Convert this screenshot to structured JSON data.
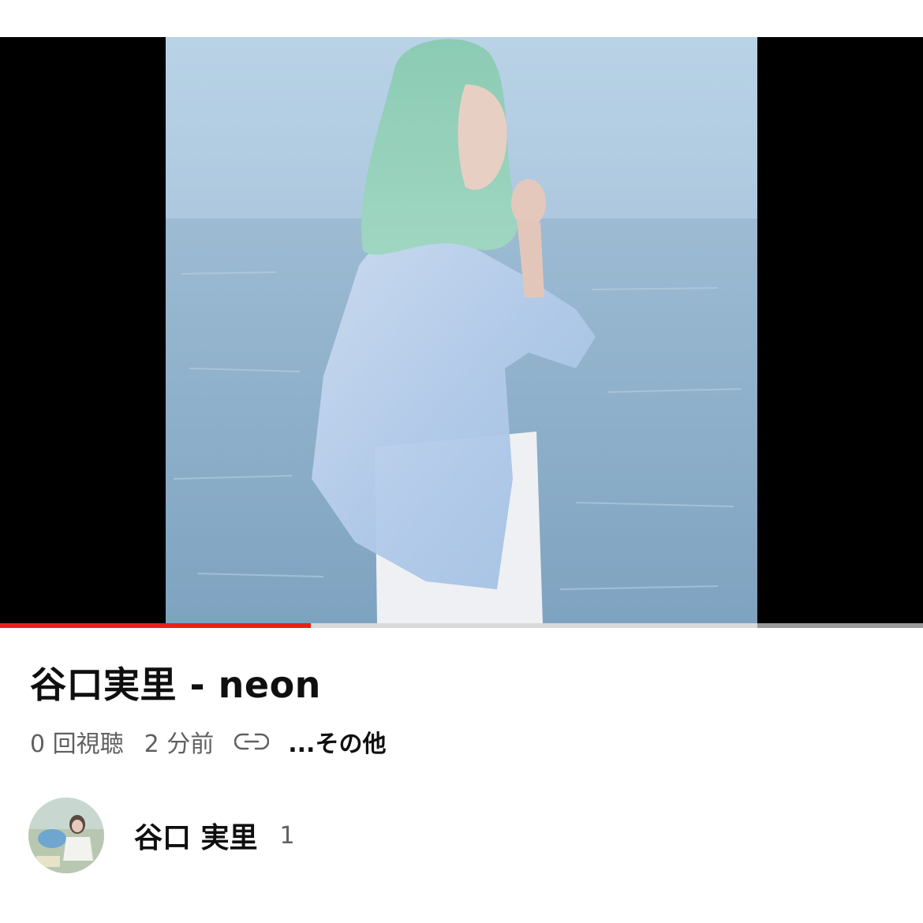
{
  "video": {
    "title": "谷口実里 - neon",
    "progress_fraction": 0.337,
    "views": "0 回視聴",
    "age": "2 分前",
    "more_label": "...その他"
  },
  "icons": {
    "share_link": "link-icon"
  },
  "channel": {
    "name": "谷口 実里",
    "subscribers": "1"
  },
  "colors": {
    "progress_played": "#e62117",
    "progress_track": "#d9d9d9",
    "text_primary": "#0f0f0f",
    "text_secondary": "#606060"
  }
}
